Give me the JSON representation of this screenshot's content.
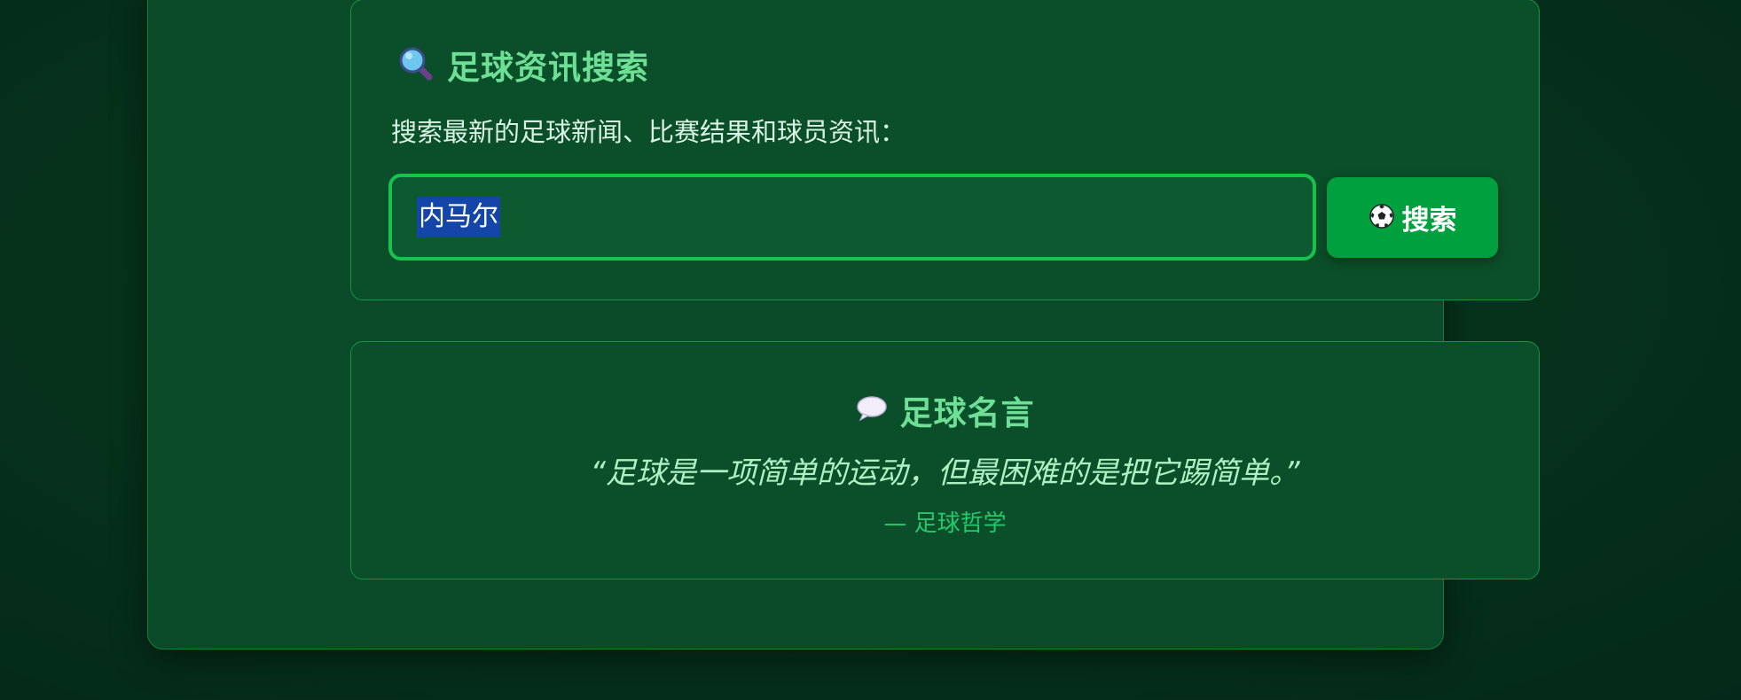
{
  "search": {
    "title": "足球资讯搜索",
    "description": "搜索最新的足球新闻、比赛结果和球员资讯：",
    "input_value": "内马尔",
    "button_label": "搜索",
    "title_icon": "magnifier-icon",
    "button_icon": "soccer-ball-icon"
  },
  "quote": {
    "title": "足球名言",
    "title_icon": "speech-bubble-icon",
    "text": "“足球是一项简单的运动，但最困难的是把它踢简单。”",
    "author": "— 足球哲学"
  },
  "colors": {
    "accent": "#6ee095",
    "button": "#00a03e",
    "input_border": "#17c24d",
    "background": "#042a16"
  }
}
